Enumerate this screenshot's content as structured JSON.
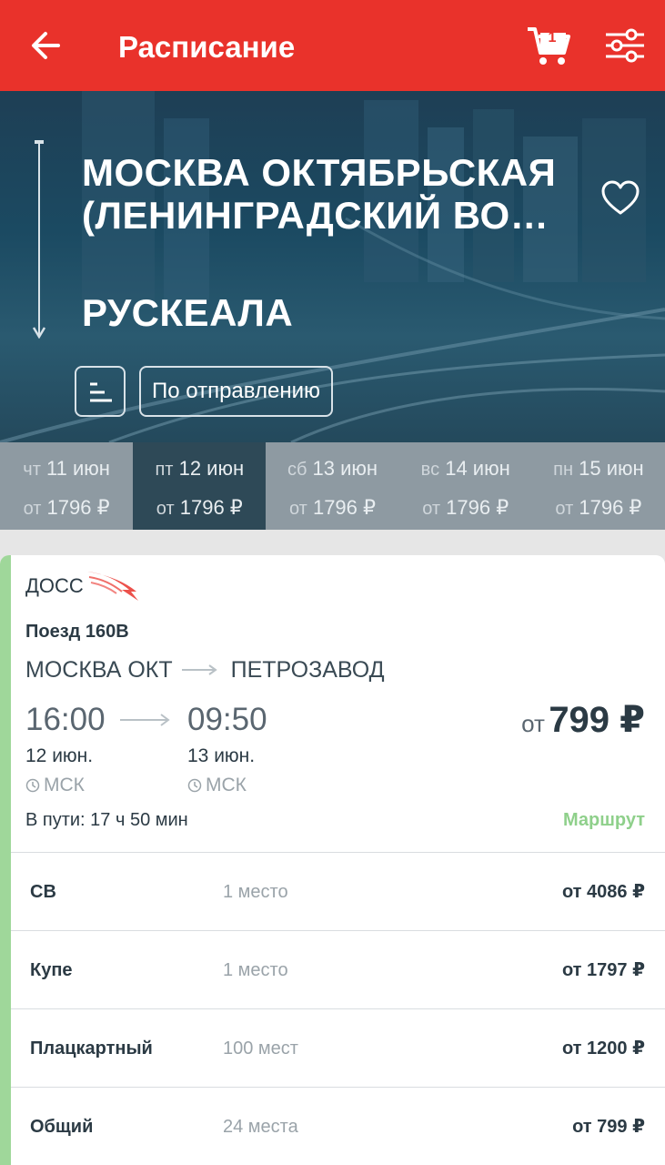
{
  "header": {
    "title": "Расписание",
    "cart_count": "1",
    "colors": {
      "bar": "#e9322b"
    },
    "icons": [
      "arrow-back-icon",
      "cart-icon",
      "filter-sliders-icon"
    ]
  },
  "hero": {
    "from": "МОСКВА ОКТЯБРЬСКАЯ (ЛЕНИНГРАДСКИЙ ВО…",
    "to": "РУСКЕАЛА",
    "sort_label": "По отправлению",
    "icons": [
      "route-arrow-icon",
      "heart-icon",
      "sort-icon"
    ]
  },
  "dates": [
    {
      "weekday": "чт",
      "date": "11 июн",
      "price_prefix": "от",
      "price": "1796 ₽",
      "active": false
    },
    {
      "weekday": "пт",
      "date": "12 июн",
      "price_prefix": "от",
      "price": "1796 ₽",
      "active": true
    },
    {
      "weekday": "сб",
      "date": "13 июн",
      "price_prefix": "от",
      "price": "1796 ₽",
      "active": false
    },
    {
      "weekday": "вс",
      "date": "14 июн",
      "price_prefix": "от",
      "price": "1796 ₽",
      "active": false
    },
    {
      "weekday": "пн",
      "date": "15 июн",
      "price_prefix": "от",
      "price": "1796 ₽",
      "active": false
    }
  ],
  "train": {
    "carrier": "ДОСС",
    "number": "Поезд 160В",
    "from_station": "МОСКВА ОКТ",
    "to_station": "ПЕТРОЗАВОД",
    "departure_time": "16:00",
    "departure_date": "12 июн.",
    "departure_tz": "МСК",
    "arrival_time": "09:50",
    "arrival_date": "13 июн.",
    "arrival_tz": "МСК",
    "price_prefix": "от",
    "price": "799 ₽",
    "duration": "В пути: 17 ч 50 мин",
    "route_link": "Маршрут",
    "accent_color": "#9fd79a"
  },
  "classes": [
    {
      "name": "СВ",
      "seats": "1 место",
      "price": "от 4086 ₽"
    },
    {
      "name": "Купе",
      "seats": "1 место",
      "price": "от 1797 ₽"
    },
    {
      "name": "Плацкартный",
      "seats": "100 мест",
      "price": "от 1200 ₽"
    },
    {
      "name": "Общий",
      "seats": "24 места",
      "price": "от 799 ₽"
    }
  ]
}
